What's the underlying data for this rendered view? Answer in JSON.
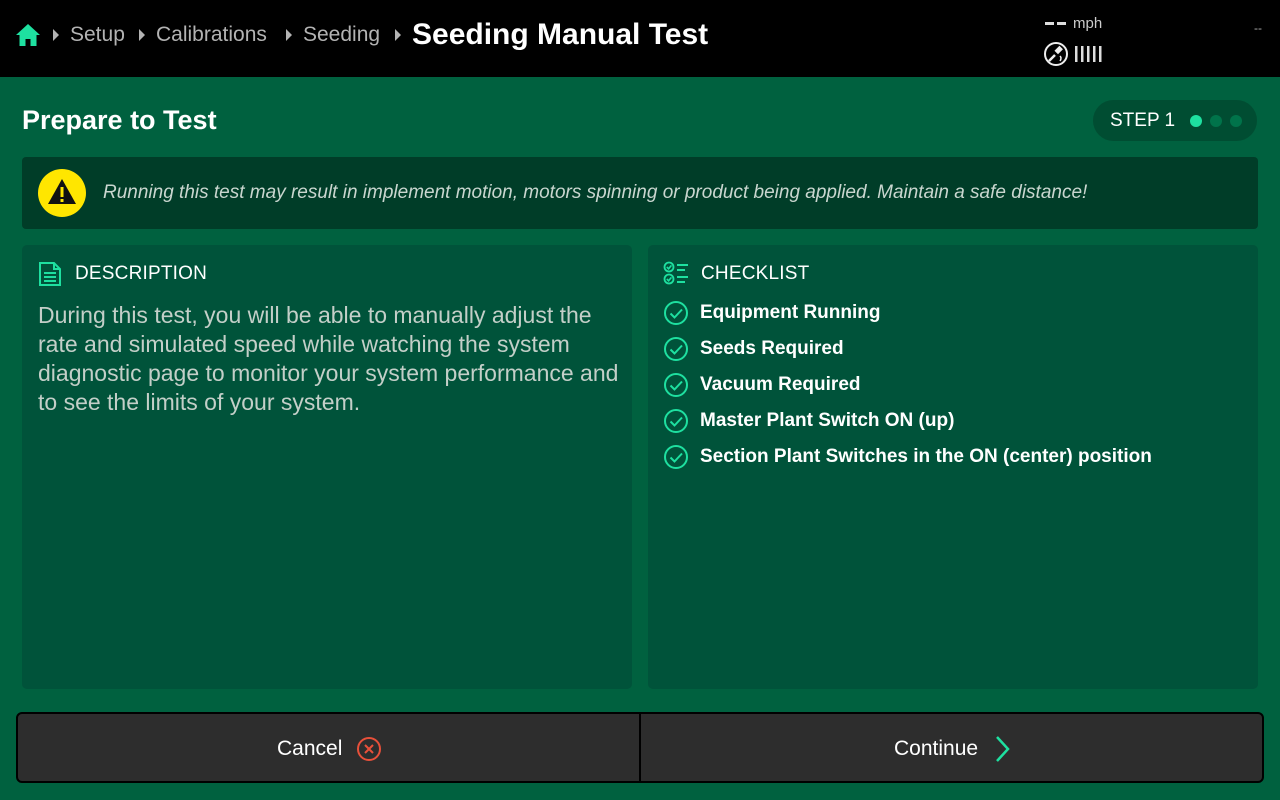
{
  "header": {
    "breadcrumb": [
      "Setup",
      "Calibrations",
      "Seeding"
    ],
    "title": "Seeding Manual Test",
    "speed_value": "--",
    "speed_unit": "mph",
    "corner_value": "--"
  },
  "section": {
    "title": "Prepare to Test",
    "step_label": "STEP 1",
    "step_current": 1,
    "step_total": 3
  },
  "warning": {
    "text": "Running this test may result in implement motion, motors spinning or product being applied. Maintain a safe distance!"
  },
  "description": {
    "heading": "DESCRIPTION",
    "body": "During this test, you will be able to manually adjust the rate and simulated speed while watching the system diagnostic page to monitor your system performance and to see the limits of your system."
  },
  "checklist": {
    "heading": "CHECKLIST",
    "items": [
      "Equipment Running",
      "Seeds Required",
      "Vacuum Required",
      "Master Plant Switch ON (up)",
      "Section Plant Switches in the ON (center) position"
    ]
  },
  "footer": {
    "cancel_label": "Cancel",
    "continue_label": "Continue"
  },
  "colors": {
    "background": "#00613f",
    "accent": "#1ee0a0",
    "warning": "#ffe600",
    "cancel_icon": "#e8503a"
  },
  "icons": {
    "home": "home-icon",
    "gps": "gps-satellite-icon",
    "signal": "signal-bars-icon",
    "warning": "warning-triangle-icon",
    "description": "document-icon",
    "checklist": "checklist-icon",
    "check": "check-circle-icon",
    "cancel": "x-circle-icon",
    "continue": "chevron-right-icon"
  }
}
